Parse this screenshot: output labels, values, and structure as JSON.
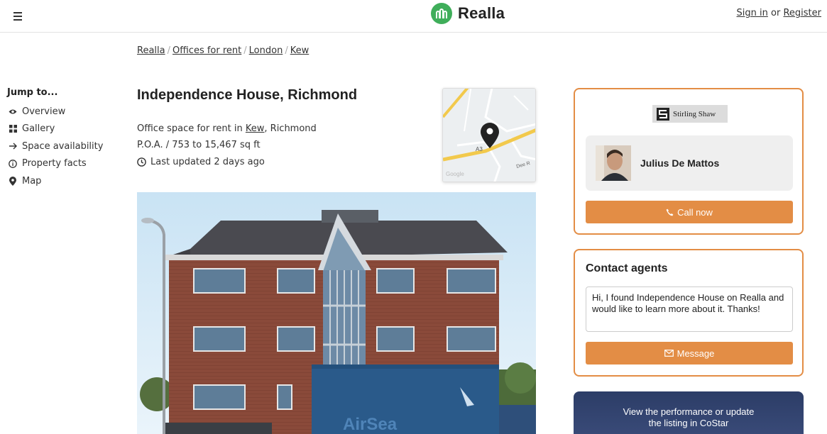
{
  "header": {
    "brand_name": "Realla",
    "sign_in": "Sign in",
    "or": "or",
    "register": "Register",
    "brand_color": "#3fae5a"
  },
  "breadcrumb": [
    "Realla",
    "Offices for rent",
    "London",
    "Kew"
  ],
  "jump_to": {
    "title": "Jump to...",
    "items": [
      {
        "label": "Overview",
        "icon": "eye-icon"
      },
      {
        "label": "Gallery",
        "icon": "grid-icon"
      },
      {
        "label": "Space availability",
        "icon": "arrow-right-icon"
      },
      {
        "label": "Property facts",
        "icon": "info-icon"
      },
      {
        "label": "Map",
        "icon": "map-pin-icon"
      }
    ]
  },
  "listing": {
    "title": "Independence House, Richmond",
    "subtitle_prefix": "Office space for rent in ",
    "subtitle_link": "Kew",
    "subtitle_suffix": ", Richmond",
    "price_size": "P.O.A. / 753 to 15,467 sq ft",
    "updated": "Last updated 2 days ago"
  },
  "map": {
    "road_label_1": "A3",
    "road_label_2": "Dee R",
    "attribution": "Google"
  },
  "photo": {
    "van_text": "AirSea"
  },
  "agent": {
    "company": "Stirling Shaw",
    "name": "Julius De Mattos",
    "call_label": "Call now"
  },
  "contact": {
    "title": "Contact agents",
    "message": "Hi, I found Independence House on Realla and would like to learn more about it. Thanks!",
    "button_label": "Message"
  },
  "costar": {
    "line1": "View the performance or update",
    "line2": "the listing in CoStar"
  },
  "colors": {
    "accent": "#e38d45",
    "costar_bg": "#2c3d67"
  }
}
